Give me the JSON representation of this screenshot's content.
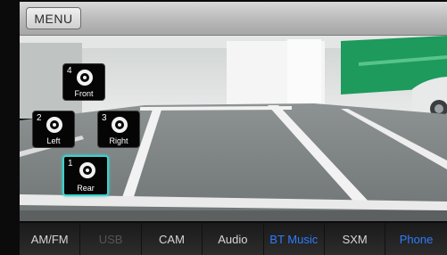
{
  "header": {
    "menu_label": "MENU"
  },
  "camera_views": [
    {
      "number": "4",
      "label": "Front",
      "selected": false
    },
    {
      "number": "2",
      "label": "Left",
      "selected": false
    },
    {
      "number": "3",
      "label": "Right",
      "selected": false
    },
    {
      "number": "1",
      "label": "Rear",
      "selected": true
    }
  ],
  "sources": [
    {
      "label": "AM/FM",
      "state": "normal"
    },
    {
      "label": "USB",
      "state": "disabled"
    },
    {
      "label": "CAM",
      "state": "normal"
    },
    {
      "label": "Audio",
      "state": "normal"
    },
    {
      "label": "BT Music",
      "state": "active"
    },
    {
      "label": "SXM",
      "state": "normal"
    },
    {
      "label": "Phone",
      "state": "active"
    }
  ],
  "colors": {
    "selected_outline": "#3fd0c9",
    "active_text": "#2f7bff",
    "wall_green": "#1d9a5c"
  }
}
